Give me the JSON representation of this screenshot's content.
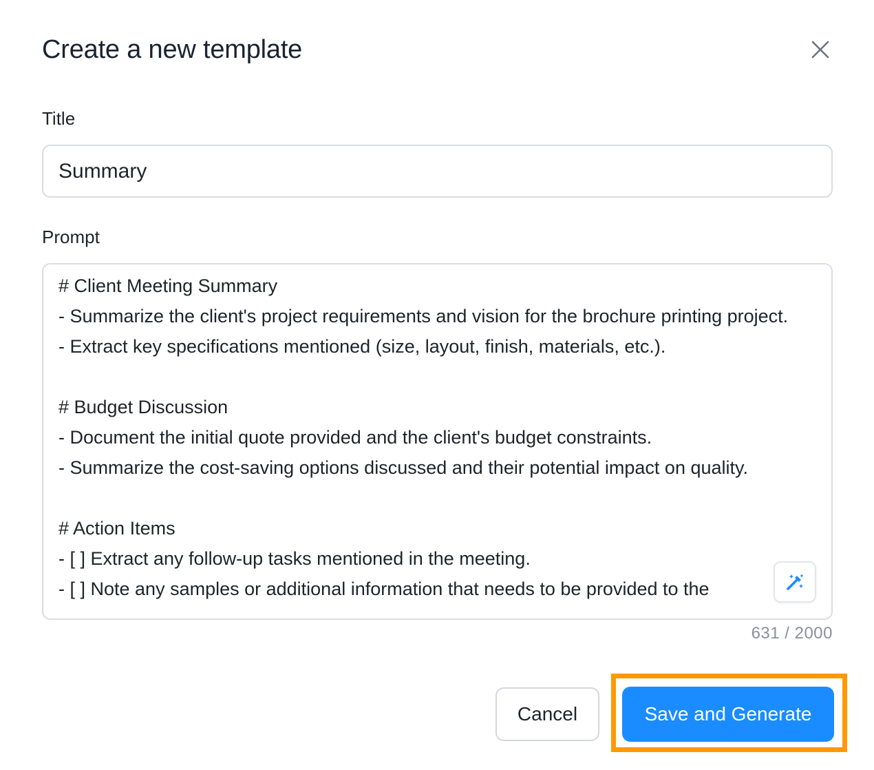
{
  "dialog": {
    "title": "Create a new template",
    "close_icon": "close-icon"
  },
  "title_field": {
    "label": "Title",
    "value": "Summary"
  },
  "prompt_field": {
    "label": "Prompt",
    "value": "# Client Meeting Summary\n- Summarize the client's project requirements and vision for the brochure printing project.\n- Extract key specifications mentioned (size, layout, finish, materials, etc.).\n\n# Budget Discussion\n- Document the initial quote provided and the client's budget constraints.\n- Summarize the cost-saving options discussed and their potential impact on quality.\n\n# Action Items\n- [ ] Extract any follow-up tasks mentioned in the meeting.\n- [ ] Note any samples or additional information that needs to be provided to the",
    "char_count": "631 / 2000",
    "magic_icon": "magic-wand-icon"
  },
  "actions": {
    "cancel_label": "Cancel",
    "primary_label": "Save and Generate"
  },
  "colors": {
    "primary": "#1a8cff",
    "highlight": "#ff9900",
    "border": "#d9dce1",
    "muted_text": "#8a9099"
  }
}
